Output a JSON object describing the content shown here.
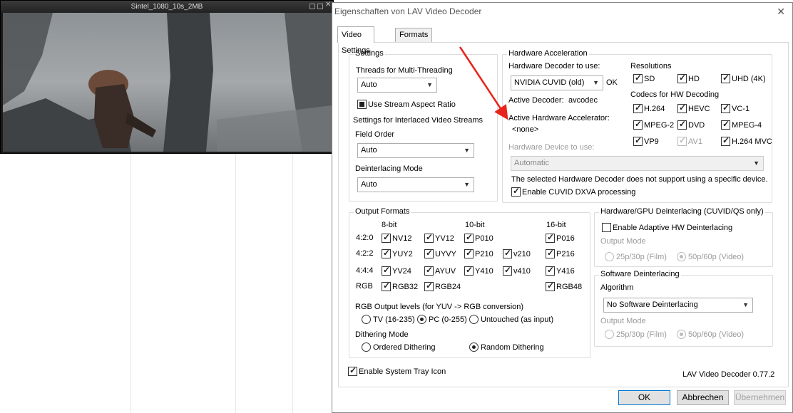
{
  "video_window": {
    "title": "Sintel_1080_10s_2MB"
  },
  "dialog": {
    "title": "Eigenschaften von LAV Video Decoder",
    "tabs": [
      "Video Settings",
      "Formats"
    ],
    "settings": {
      "group": "Settings",
      "threads_label": "Threads for Multi-Threading",
      "threads_value": "Auto",
      "aspect_ratio": {
        "label": "Use Stream Aspect Ratio",
        "state": "indeterminate"
      },
      "interlaced_label": "Settings for Interlaced Video Streams",
      "field_order_label": "Field Order",
      "field_order_value": "Auto",
      "deint_mode_label": "Deinterlacing Mode",
      "deint_mode_value": "Auto"
    },
    "hw": {
      "group": "Hardware Acceleration",
      "decoder_label": "Hardware Decoder to use:",
      "decoder_value": "NVIDIA CUVID (old)",
      "decoder_status": "OK",
      "active_decoder_label": "Active Decoder:",
      "active_decoder_value": "avcodec",
      "active_accel_label": "Active Hardware Accelerator:",
      "active_accel_value": "<none>",
      "device_label": "Hardware Device to use:",
      "device_value": "Automatic",
      "device_note": "The selected Hardware Decoder does not support using a specific device.",
      "dxva_label": "Enable CUVID DXVA processing",
      "resolutions_label": "Resolutions",
      "resolutions": [
        {
          "label": "SD",
          "checked": true
        },
        {
          "label": "HD",
          "checked": true
        },
        {
          "label": "UHD (4K)",
          "checked": true
        }
      ],
      "codecs_label": "Codecs for HW Decoding",
      "codecs": [
        {
          "label": "H.264",
          "checked": true,
          "enabled": true
        },
        {
          "label": "HEVC",
          "checked": true,
          "enabled": true
        },
        {
          "label": "VC-1",
          "checked": true,
          "enabled": true
        },
        {
          "label": "MPEG-2",
          "checked": true,
          "enabled": true
        },
        {
          "label": "DVD",
          "checked": true,
          "enabled": true
        },
        {
          "label": "MPEG-4",
          "checked": true,
          "enabled": true
        },
        {
          "label": "VP9",
          "checked": true,
          "enabled": true
        },
        {
          "label": "AV1",
          "checked": true,
          "enabled": false
        },
        {
          "label": "H.264 MVC",
          "checked": true,
          "enabled": true
        }
      ]
    },
    "output": {
      "group": "Output Formats",
      "col_headers": [
        "8-bit",
        "10-bit",
        "16-bit"
      ],
      "row_labels": [
        "4:2:0",
        "4:2:2",
        "4:4:4",
        "RGB"
      ],
      "formats": [
        "NV12",
        "YV12",
        "P010",
        "P016",
        "YUY2",
        "UYVY",
        "P210",
        "v210",
        "P216",
        "YV24",
        "AYUV",
        "Y410",
        "v410",
        "Y416",
        "RGB32",
        "RGB24",
        "RGB48"
      ],
      "levels_label": "RGB Output levels (for YUV -> RGB conversion)",
      "levels": [
        "TV (16-235)",
        "PC (0-255)",
        "Untouched (as input)"
      ],
      "dither_label": "Dithering Mode",
      "dither": [
        "Ordered Dithering",
        "Random Dithering"
      ]
    },
    "hwdeint": {
      "group": "Hardware/GPU Deinterlacing (CUVID/QS only)",
      "adaptive_label": "Enable Adaptive HW Deinterlacing",
      "output_mode_label": "Output Mode",
      "modes": [
        "25p/30p (Film)",
        "50p/60p (Video)"
      ]
    },
    "swdeint": {
      "group": "Software Deinterlacing",
      "algorithm_label": "Algorithm",
      "algorithm_value": "No Software Deinterlacing",
      "output_mode_label": "Output Mode",
      "modes": [
        "25p/30p (Film)",
        "50p/60p (Video)"
      ]
    },
    "tray_label": "Enable System Tray Icon",
    "version": "LAV Video Decoder 0.77.2",
    "buttons": {
      "ok": "OK",
      "cancel": "Abbrechen",
      "apply": "Übernehmen"
    },
    "colors": {
      "annotation_arrow": "#e8231c",
      "default_button_border": "#0078d7"
    }
  }
}
